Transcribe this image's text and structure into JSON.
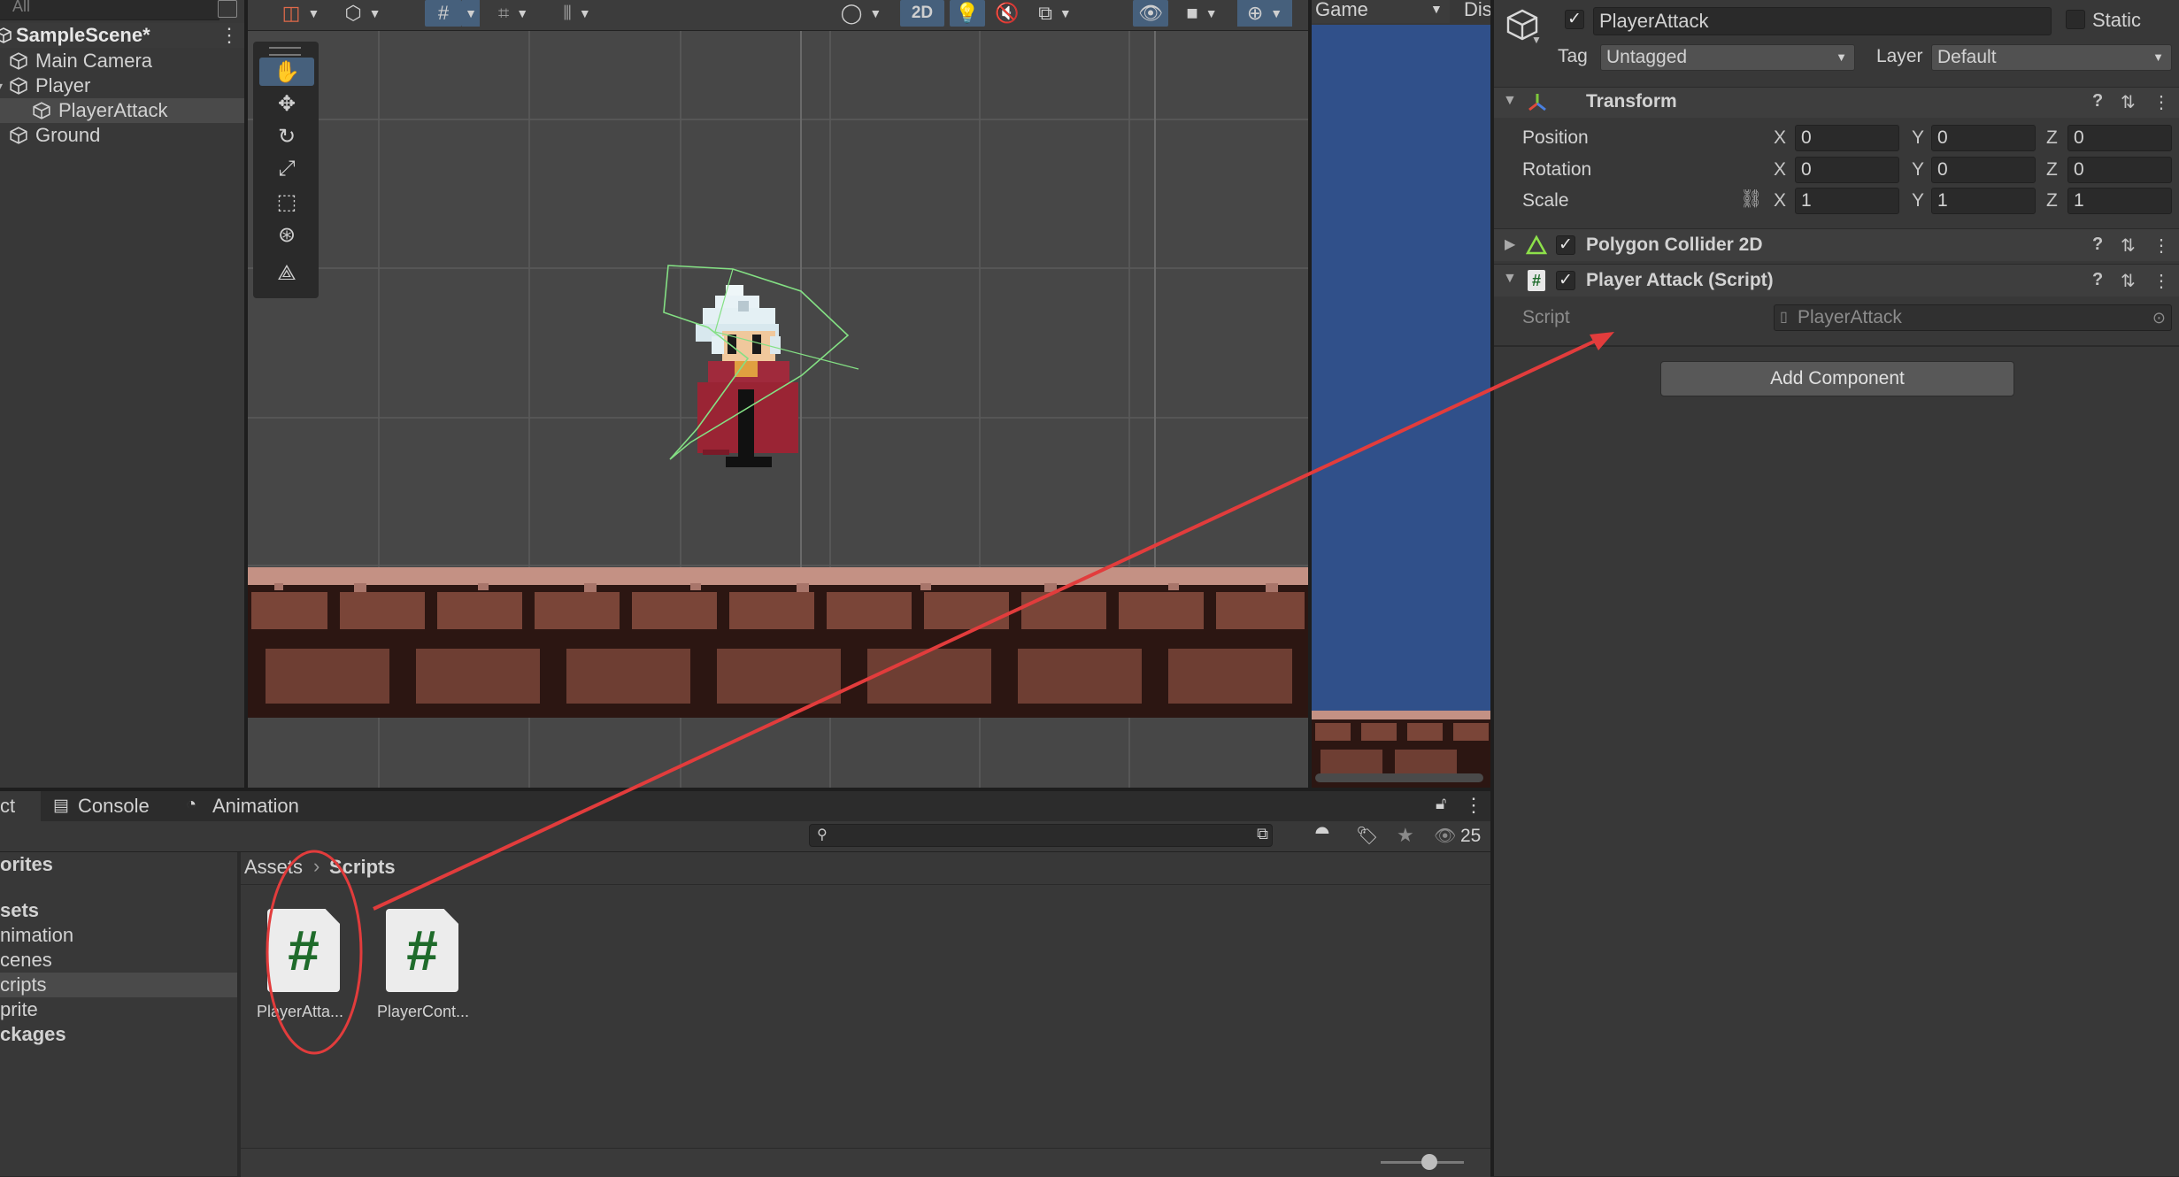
{
  "hierarchy": {
    "search_placeholder": "All",
    "scene": "SampleScene*",
    "items": [
      {
        "label": "Main Camera",
        "depth": 0
      },
      {
        "label": "Player",
        "depth": 0
      },
      {
        "label": "PlayerAttack",
        "depth": 1
      },
      {
        "label": "Ground",
        "depth": 0
      }
    ]
  },
  "scene_toolbar": {
    "mode_2d": "2D"
  },
  "game_view": {
    "tab": "Game",
    "display_tab": "Dis"
  },
  "inspector": {
    "object_name": "PlayerAttack",
    "static_label": "Static",
    "tag_label": "Tag",
    "tag_value": "Untagged",
    "layer_label": "Layer",
    "layer_value": "Default",
    "transform": {
      "title": "Transform",
      "position_label": "Position",
      "rotation_label": "Rotation",
      "scale_label": "Scale",
      "axis_x": "X",
      "axis_y": "Y",
      "axis_z": "Z",
      "position": [
        "0",
        "0",
        "0"
      ],
      "rotation": [
        "0",
        "0",
        "0"
      ],
      "scale": [
        "1",
        "1",
        "1"
      ]
    },
    "polygon_collider": "Polygon Collider 2D",
    "player_attack": "Player Attack (Script)",
    "script_label": "Script",
    "script_value": "PlayerAttack",
    "add_component": "Add Component",
    "help_icon": "?"
  },
  "bottom": {
    "tabs": [
      "ct",
      "Console",
      "Animation"
    ],
    "sidebar": [
      "orites",
      "",
      "sets",
      "nimation",
      "cenes",
      "cripts",
      "prite",
      "ckages"
    ],
    "breadcrumb_root": "Assets",
    "breadcrumb_current": "Scripts",
    "visible_count": "25",
    "files": [
      "PlayerAtta...",
      "PlayerCont..."
    ],
    "script_glyph": "#"
  },
  "colors": {
    "panel": "#383838",
    "scene_bg": "#474747",
    "game_sky": "#30508a",
    "annotation": "#e23c3c",
    "collider": "#84e084",
    "selection": "#46607c",
    "script_hash": "#1f6b2b"
  }
}
